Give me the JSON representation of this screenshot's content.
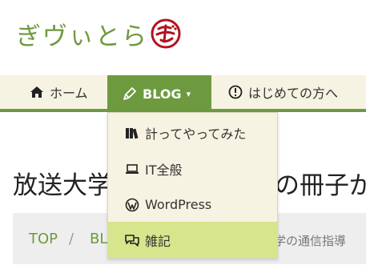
{
  "site": {
    "logo_text": "ぎヴぃとら",
    "logo_mark_char": "ぎ",
    "brand_color": "#6e9a3f",
    "mark_color": "#b3121d"
  },
  "nav": {
    "home": {
      "label": "ホーム",
      "icon": "home-icon"
    },
    "blog": {
      "label": "BLOG",
      "icon": "pen-icon",
      "caret": "▾"
    },
    "first_time": {
      "label": "はじめての方へ",
      "icon": "exclamation-circle-icon"
    }
  },
  "dropdown": {
    "items": [
      {
        "label": "計ってやってみた",
        "icon": "books-icon"
      },
      {
        "label": "IT全般",
        "icon": "laptop-icon"
      },
      {
        "label": "WordPress",
        "icon": "wordpress-icon"
      },
      {
        "label": "雑記",
        "icon": "comments-icon",
        "highlight": "#d7e58d"
      }
    ]
  },
  "page": {
    "title_visible_left": "放送大学",
    "title_visible_right": "の冊子が"
  },
  "breadcrumb": {
    "top": "TOP",
    "separator": "/",
    "blog": "BLOG",
    "tail": "学の通信指導"
  }
}
